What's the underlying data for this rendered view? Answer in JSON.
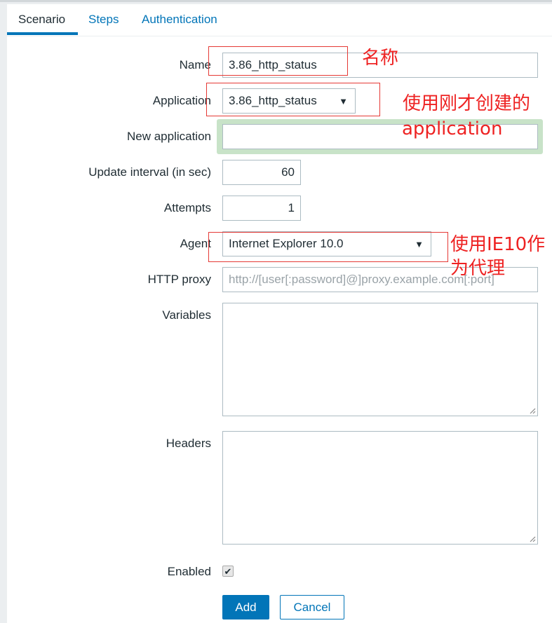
{
  "tabs": [
    {
      "label": "Scenario",
      "active": true
    },
    {
      "label": "Steps",
      "active": false
    },
    {
      "label": "Authentication",
      "active": false
    }
  ],
  "form": {
    "name": {
      "label": "Name",
      "value": "3.86_http_status"
    },
    "application": {
      "label": "Application",
      "value": "3.86_http_status"
    },
    "new_application": {
      "label": "New application",
      "value": ""
    },
    "update_interval": {
      "label": "Update interval (in sec)",
      "value": "60"
    },
    "attempts": {
      "label": "Attempts",
      "value": "1"
    },
    "agent": {
      "label": "Agent",
      "value": "Internet Explorer 10.0"
    },
    "http_proxy": {
      "label": "HTTP proxy",
      "value": "",
      "placeholder": "http://[user[:password]@]proxy.example.com[:port]"
    },
    "variables": {
      "label": "Variables",
      "value": ""
    },
    "headers": {
      "label": "Headers",
      "value": ""
    },
    "enabled": {
      "label": "Enabled",
      "checked": true
    }
  },
  "buttons": {
    "add": "Add",
    "cancel": "Cancel"
  },
  "annotations": {
    "name_note": "名称",
    "application_note_line1": "使用刚才创建的",
    "application_note_line2": "application",
    "agent_note_line1": "使用IE10作",
    "agent_note_line2": "为代理"
  },
  "colors": {
    "accent": "#0275b8",
    "annotation": "#ee2222",
    "highlight": "#c8e3c8"
  }
}
